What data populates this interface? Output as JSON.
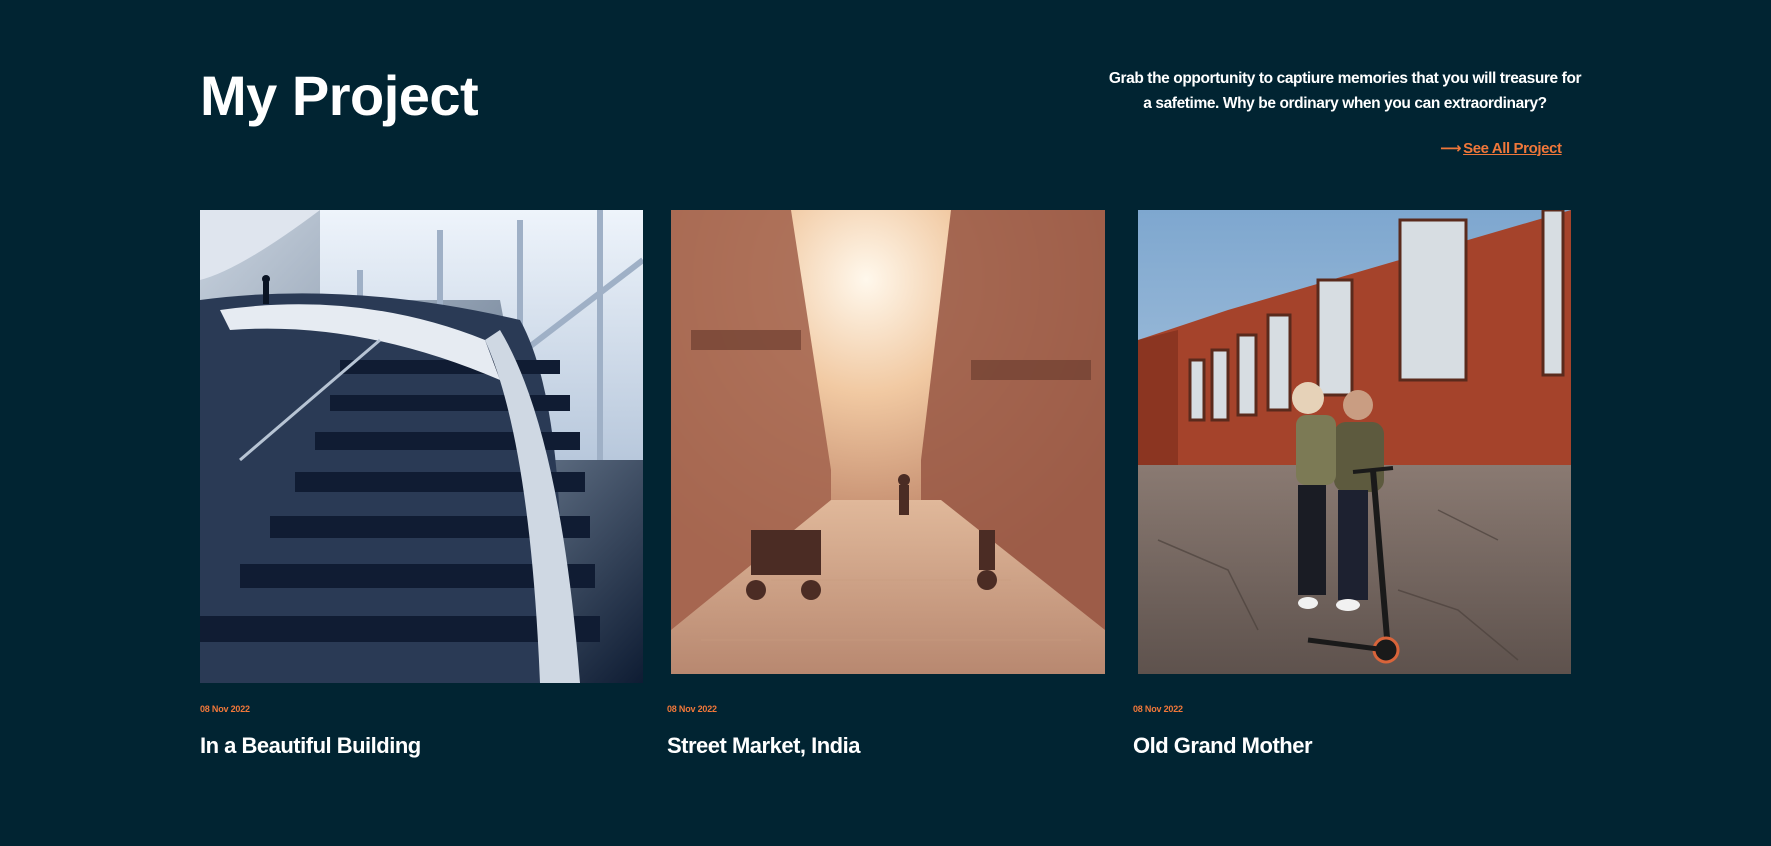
{
  "header": {
    "title": "My Project",
    "tagline_line1": "Grab the opportunity to captiure memories that you will treasure for",
    "tagline_line2": "a safetime. Why be ordinary when you can extraordinary?",
    "see_all_arrow": "⟶",
    "see_all_label": "See All Project"
  },
  "projects": [
    {
      "date": "08 Nov 2022",
      "title": "In a Beautiful Building",
      "image": "staircase-photo"
    },
    {
      "date": "08 Nov 2022",
      "title": "Street Market, India",
      "image": "street-market-photo"
    },
    {
      "date": "08 Nov 2022",
      "title": "Old Grand Mother",
      "image": "couple-scooter-photo"
    }
  ],
  "colors": {
    "background": "#012432",
    "accent": "#f0773a",
    "text": "#ffffff"
  }
}
